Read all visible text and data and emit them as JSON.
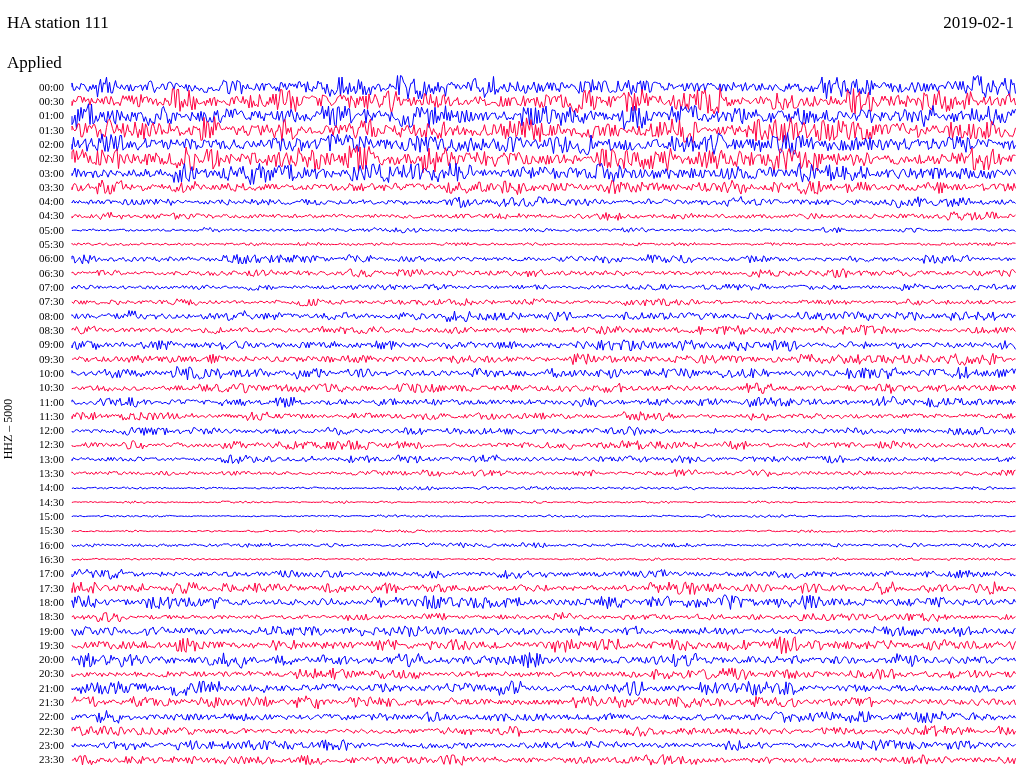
{
  "header": {
    "station": "HA station 111",
    "filter": "Applied",
    "date": "2019-02-1"
  },
  "axis_label": "HHZ – 5000",
  "rows": [
    {
      "time": "00:00",
      "color": "#0000ff"
    },
    {
      "time": "00:30",
      "color": "#ff0040"
    },
    {
      "time": "01:00",
      "color": "#0000ff"
    },
    {
      "time": "01:30",
      "color": "#ff0040"
    },
    {
      "time": "02:00",
      "color": "#0000ff"
    },
    {
      "time": "02:30",
      "color": "#ff0040"
    },
    {
      "time": "03:00",
      "color": "#0000ff"
    },
    {
      "time": "03:30",
      "color": "#ff0040"
    },
    {
      "time": "04:00",
      "color": "#0000ff"
    },
    {
      "time": "04:30",
      "color": "#ff0040"
    },
    {
      "time": "05:00",
      "color": "#0000ff"
    },
    {
      "time": "05:30",
      "color": "#ff0040"
    },
    {
      "time": "06:00",
      "color": "#0000ff"
    },
    {
      "time": "06:30",
      "color": "#ff0040"
    },
    {
      "time": "07:00",
      "color": "#0000ff"
    },
    {
      "time": "07:30",
      "color": "#ff0040"
    },
    {
      "time": "08:00",
      "color": "#0000ff"
    },
    {
      "time": "08:30",
      "color": "#ff0040"
    },
    {
      "time": "09:00",
      "color": "#0000ff"
    },
    {
      "time": "09:30",
      "color": "#ff0040"
    },
    {
      "time": "10:00",
      "color": "#0000ff"
    },
    {
      "time": "10:30",
      "color": "#ff0040"
    },
    {
      "time": "11:00",
      "color": "#0000ff"
    },
    {
      "time": "11:30",
      "color": "#ff0040"
    },
    {
      "time": "12:00",
      "color": "#0000ff"
    },
    {
      "time": "12:30",
      "color": "#ff0040"
    },
    {
      "time": "13:00",
      "color": "#0000ff"
    },
    {
      "time": "13:30",
      "color": "#ff0040"
    },
    {
      "time": "14:00",
      "color": "#0000ff"
    },
    {
      "time": "14:30",
      "color": "#ff0040"
    },
    {
      "time": "15:00",
      "color": "#0000ff"
    },
    {
      "time": "15:30",
      "color": "#ff0040"
    },
    {
      "time": "16:00",
      "color": "#0000ff"
    },
    {
      "time": "16:30",
      "color": "#ff0040"
    },
    {
      "time": "17:00",
      "color": "#0000ff"
    },
    {
      "time": "17:30",
      "color": "#ff0040"
    },
    {
      "time": "18:00",
      "color": "#0000ff"
    },
    {
      "time": "18:30",
      "color": "#ff0040"
    },
    {
      "time": "19:00",
      "color": "#0000ff"
    },
    {
      "time": "19:30",
      "color": "#ff0040"
    },
    {
      "time": "20:00",
      "color": "#0000ff"
    },
    {
      "time": "20:30",
      "color": "#ff0040"
    },
    {
      "time": "21:00",
      "color": "#0000ff"
    },
    {
      "time": "21:30",
      "color": "#ff0040"
    },
    {
      "time": "22:00",
      "color": "#0000ff"
    },
    {
      "time": "22:30",
      "color": "#ff0040"
    },
    {
      "time": "23:00",
      "color": "#0000ff"
    },
    {
      "time": "23:30",
      "color": "#ff0040"
    }
  ]
}
